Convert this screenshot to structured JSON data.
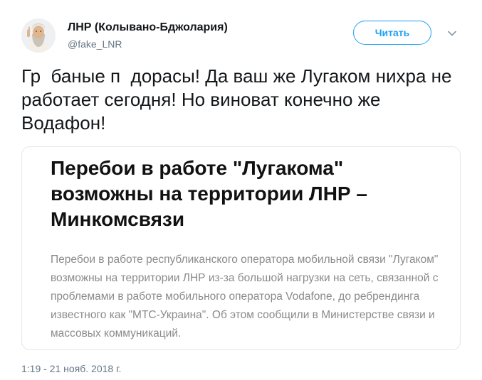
{
  "tweet": {
    "display_name": "ЛНР (Колывано-Бджолария)",
    "handle": "@fake_LNR",
    "follow_label": "Читать",
    "text": "Гр  баные п  дорасы! Да ваш же Лугаком нихра не работает сегодня! Но виноват конечно же Водафон!",
    "timestamp": "1:19 - 21 нояб. 2018 г.",
    "accent_color": "#1da1f2",
    "icons": {
      "avatar": "bearded-man-avatar",
      "menu": "chevron-down-icon"
    }
  },
  "card": {
    "headline": "Перебои в работе \"Лугакома\" возможны на территории ЛНР – Минкомсвязи",
    "description": "Перебои в работе республиканского оператора мобильной связи \"Лугаком\" возможны на территории ЛНР из-за большой нагрузки на сеть, связанной с проблемами в работе мобильного оператора Vodafone, до ребрендинга известного как \"МТС-Украина\". Об этом сообщили в Министерстве связи и массовых коммуникаций."
  }
}
